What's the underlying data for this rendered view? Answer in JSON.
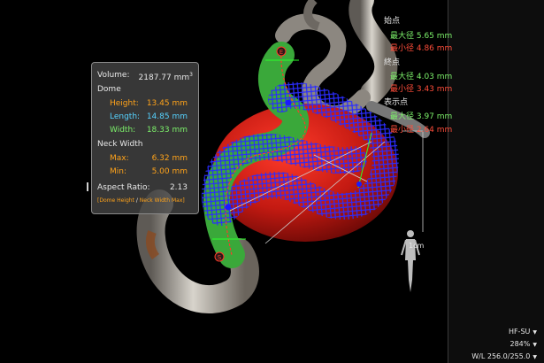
{
  "measurements": {
    "volume_label": "Volume:",
    "volume_value": "2187.77 mm",
    "volume_sup": "3",
    "dome_heading": "Dome",
    "height_label": "Height:",
    "height_value": "13.45 mm",
    "length_label": "Length:",
    "length_value": "14.85 mm",
    "width_label": "Width:",
    "width_value": "18.33 mm",
    "neck_heading": "Neck Width",
    "max_label": "Max:",
    "max_value": "6.32 mm",
    "min_label": "Min:",
    "min_value": "5.00 mm",
    "aspect_label": "Aspect Ratio:",
    "aspect_value": "2.13",
    "aspect_note_open": "[",
    "aspect_note_num": "Dome Height",
    "aspect_note_sep": "/",
    "aspect_note_den": "Neck Width Max",
    "aspect_note_close": "]"
  },
  "diameters": {
    "start": {
      "title": "始点",
      "max": "最大径 5.65 mm",
      "min": "最小径 4.86 mm"
    },
    "end": {
      "title": "終点",
      "max": "最大径 4.03 mm",
      "min": "最小径 3.43 mm"
    },
    "display": {
      "title": "表示点",
      "max": "最大径 3.97 mm",
      "min": "最小径 2.64 mm"
    }
  },
  "markers": {
    "start": "S",
    "end": "E"
  },
  "scale": {
    "label": "1cm"
  },
  "readouts": {
    "preset": "HF-SU",
    "zoom": "284%",
    "window": "W/L 256.0/255.0"
  },
  "colors": {
    "max": "#7cf06a",
    "min": "#ff4d3a",
    "height": "#ffa31a",
    "length": "#56d2ff",
    "width": "#7cf06a"
  }
}
